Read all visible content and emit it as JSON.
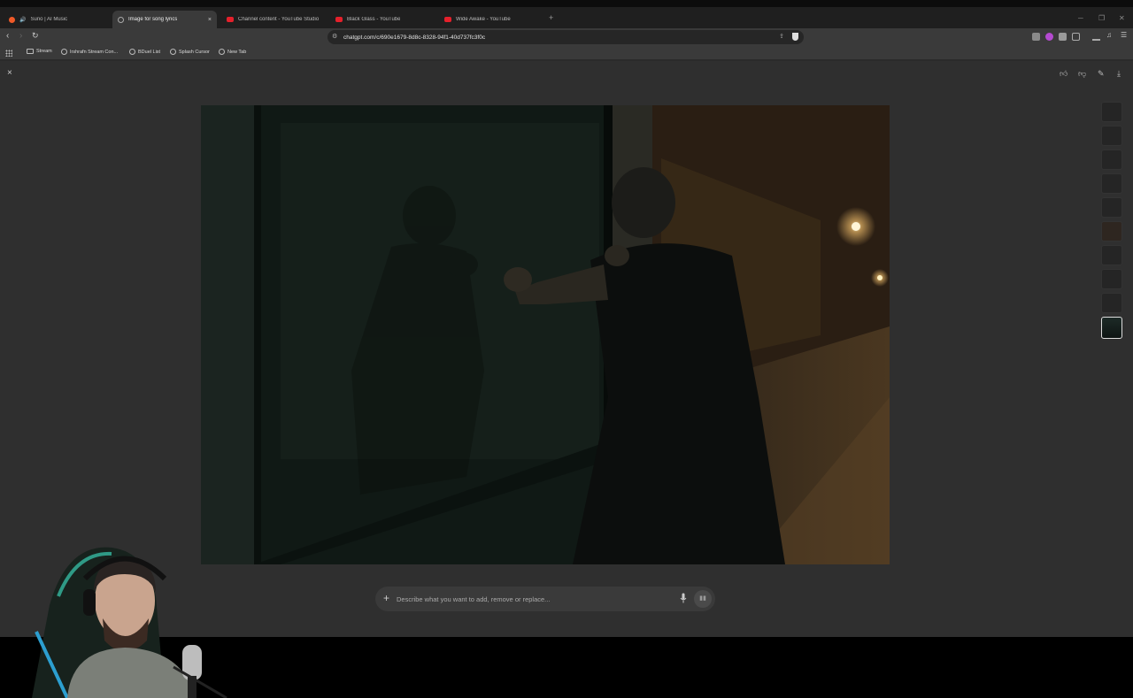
{
  "browser": {
    "tabs": [
      {
        "label": "Suno | AI Music",
        "favicon": "suno-icon",
        "audio": true,
        "active": false
      },
      {
        "label": "Image for song lyrics",
        "favicon": "globe-icon",
        "audio": false,
        "active": true
      },
      {
        "label": "Channel content - YouTube Studio",
        "favicon": "youtube-icon",
        "audio": false,
        "active": false
      },
      {
        "label": "Black Glass - YouTube",
        "favicon": "youtube-icon",
        "audio": false,
        "active": false
      },
      {
        "label": "Wide Awake - YouTube",
        "favicon": "youtube-icon",
        "audio": false,
        "active": false
      }
    ],
    "tab_close_glyph": "×",
    "new_tab_glyph": "+",
    "address": "chatgpt.com/c/690e1679-8d8c-8328-94f1-40d737fc3f0c",
    "bookmarks": [
      {
        "label": "Stream",
        "icon": "folder-icon"
      },
      {
        "label": "Irshrafn Stream Con...",
        "icon": "globe-icon"
      },
      {
        "label": "BDuel List",
        "icon": "globe-icon"
      },
      {
        "label": "Splash Cursor",
        "icon": "globe-icon"
      },
      {
        "label": "New Tab",
        "icon": "globe-icon"
      }
    ]
  },
  "viewer": {
    "close_glyph": "×",
    "prompt_placeholder": "Describe what you want to add, remove or replace...",
    "thumbnail_count": 10,
    "selected_thumbnail": 10
  },
  "colors": {
    "background": "#2f2f2f",
    "tabstrip": "#1f1f1f",
    "toolbar": "#3a3a3a",
    "youtube_red": "#e5202b",
    "accent_text": "#dddddd"
  }
}
